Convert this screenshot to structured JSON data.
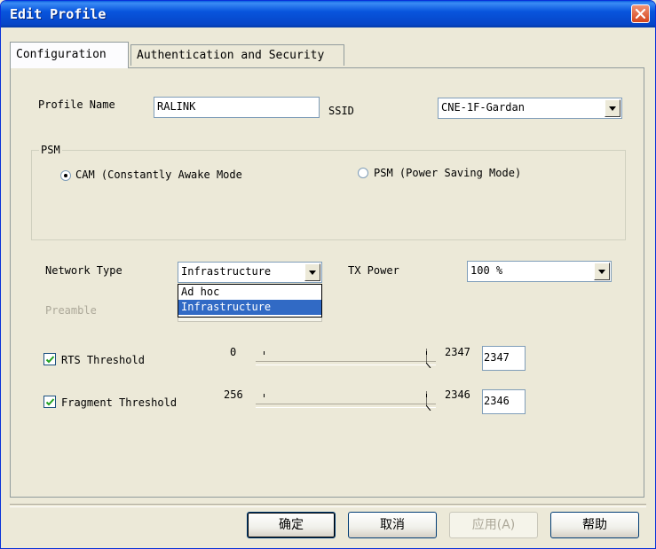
{
  "window": {
    "title": "Edit Profile"
  },
  "tabs": [
    {
      "label": "Configuration",
      "active": true
    },
    {
      "label": "Authentication and Security",
      "active": false
    }
  ],
  "profile": {
    "profile_name_label": "Profile Name",
    "profile_name_value": "RALINK",
    "ssid_label": "SSID",
    "ssid_value": "CNE-1F-Gardan"
  },
  "psm": {
    "group_label": "PSM",
    "options": [
      {
        "label": "CAM (Constantly Awake Mode",
        "checked": true
      },
      {
        "label": "PSM (Power Saving Mode)",
        "checked": false
      }
    ]
  },
  "network": {
    "type_label": "Network Type",
    "type_value": "Infrastructure",
    "type_options": [
      "Ad hoc",
      "Infrastructure"
    ],
    "type_selected_index": 1,
    "tx_power_label": "TX Power",
    "tx_power_value": "100 %",
    "preamble_label": "Preamble"
  },
  "rts": {
    "label": "RTS Threshold",
    "checked": true,
    "min": "0",
    "max": "2347",
    "value": "2347"
  },
  "fragment": {
    "label": "Fragment Threshold",
    "checked": true,
    "min": "256",
    "max": "2346",
    "value": "2346"
  },
  "buttons": {
    "ok": "确定",
    "cancel": "取消",
    "apply": "应用(A)",
    "help": "帮助"
  },
  "colors": {
    "title_bar": "#0855DD",
    "selection": "#316AC5",
    "dialog_bg": "#ECE9D8"
  }
}
